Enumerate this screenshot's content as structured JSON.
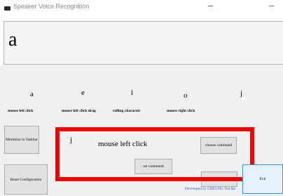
{
  "window": {
    "title": "Speaker Voice Recognition",
    "icon": "app-icon",
    "minimize_glyph": "–",
    "maximize_glyph": "–"
  },
  "display": {
    "text": "a"
  },
  "keys": [
    {
      "letter": "a",
      "action": "mouse left click"
    },
    {
      "letter": "e",
      "action": "mouse left click drag"
    },
    {
      "letter": "i",
      "action": "rolling character"
    },
    {
      "letter": "o",
      "action": "mouse right click"
    },
    {
      "letter": "j",
      "action": ""
    }
  ],
  "buttons": {
    "minimize_taskbar": "Minimize in Taskbar",
    "reset_configuration": "Reset Configuration",
    "choose_command": "choose command",
    "set_command": "set command",
    "hidden_button": "",
    "exit": "Exit"
  },
  "selection": {
    "letter": "j",
    "action": "mouse left click"
  },
  "footer": "Developed by CHEUNG Dai Ho",
  "colors": {
    "highlight": "#ee0000",
    "footer": "#2a55c8",
    "exit_border": "#3c8fd8"
  }
}
